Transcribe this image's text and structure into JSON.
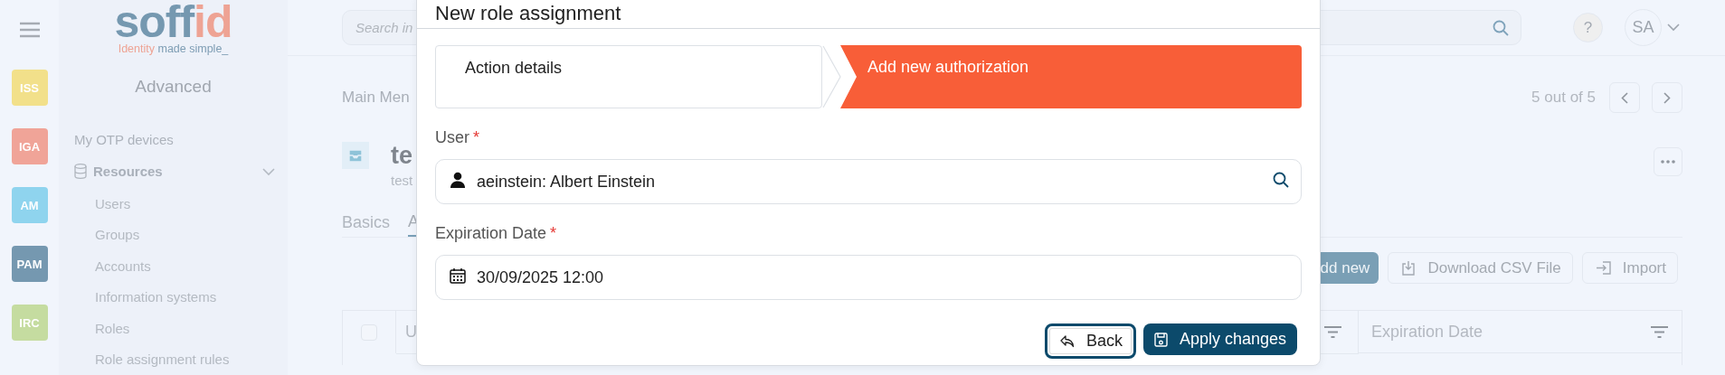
{
  "rail": {
    "items": [
      {
        "label": "ISS",
        "color": "#f2e08a"
      },
      {
        "label": "IGA",
        "color": "#f0a498"
      },
      {
        "label": "AM",
        "color": "#8fd4ee"
      },
      {
        "label": "PAM",
        "color": "#7598b0"
      },
      {
        "label": "IRC",
        "color": "#c5dca0"
      }
    ]
  },
  "sidebar": {
    "logo": {
      "word_a": "soff",
      "word_b": "id",
      "tagline_a": "Identity",
      "tagline_b": "made simple_"
    },
    "section": "Advanced",
    "items": [
      {
        "label": "My OTP devices",
        "kind": "link"
      },
      {
        "label": "Resources",
        "kind": "group",
        "expanded": true,
        "children": [
          {
            "label": "Users"
          },
          {
            "label": "Groups"
          },
          {
            "label": "Accounts"
          },
          {
            "label": "Information systems"
          },
          {
            "label": "Roles"
          },
          {
            "label": "Role assignment rules"
          }
        ]
      }
    ]
  },
  "topbar": {
    "search": {
      "placeholder": "Search in"
    },
    "help": "?",
    "avatar": "SA"
  },
  "record": {
    "breadcrumb": "Main Men",
    "pager": "5 out of 5",
    "title": "te",
    "subtitle": "test"
  },
  "tabs": [
    {
      "label": "Basics",
      "selected": false
    },
    {
      "label": "A",
      "selected": true
    }
  ],
  "actions": [
    {
      "label": "dd new",
      "kind": "primary"
    },
    {
      "label": "Download CSV File",
      "kind": "download"
    },
    {
      "label": "Import",
      "kind": "import"
    }
  ],
  "table": {
    "select_all": {
      "checked": false
    },
    "columns": [
      {
        "label": "U"
      },
      {
        "label": "Expiration Date"
      }
    ]
  },
  "dialog": {
    "title": "New role assignment",
    "steps": [
      {
        "label": "Action details",
        "selected": false
      },
      {
        "label": "Add new authorization",
        "selected": true
      }
    ],
    "fields": [
      {
        "label": "User",
        "required_mark": "*",
        "value": "aeinstein: Albert Einstein",
        "kind": "user"
      },
      {
        "label": "Expiration Date",
        "required_mark": "*",
        "value": "30/09/2025 12:00",
        "kind": "date"
      }
    ],
    "buttons": [
      {
        "label": "Back",
        "kind": "secondary",
        "focused": true
      },
      {
        "label": "Apply changes",
        "kind": "primary",
        "focused": false
      }
    ]
  }
}
